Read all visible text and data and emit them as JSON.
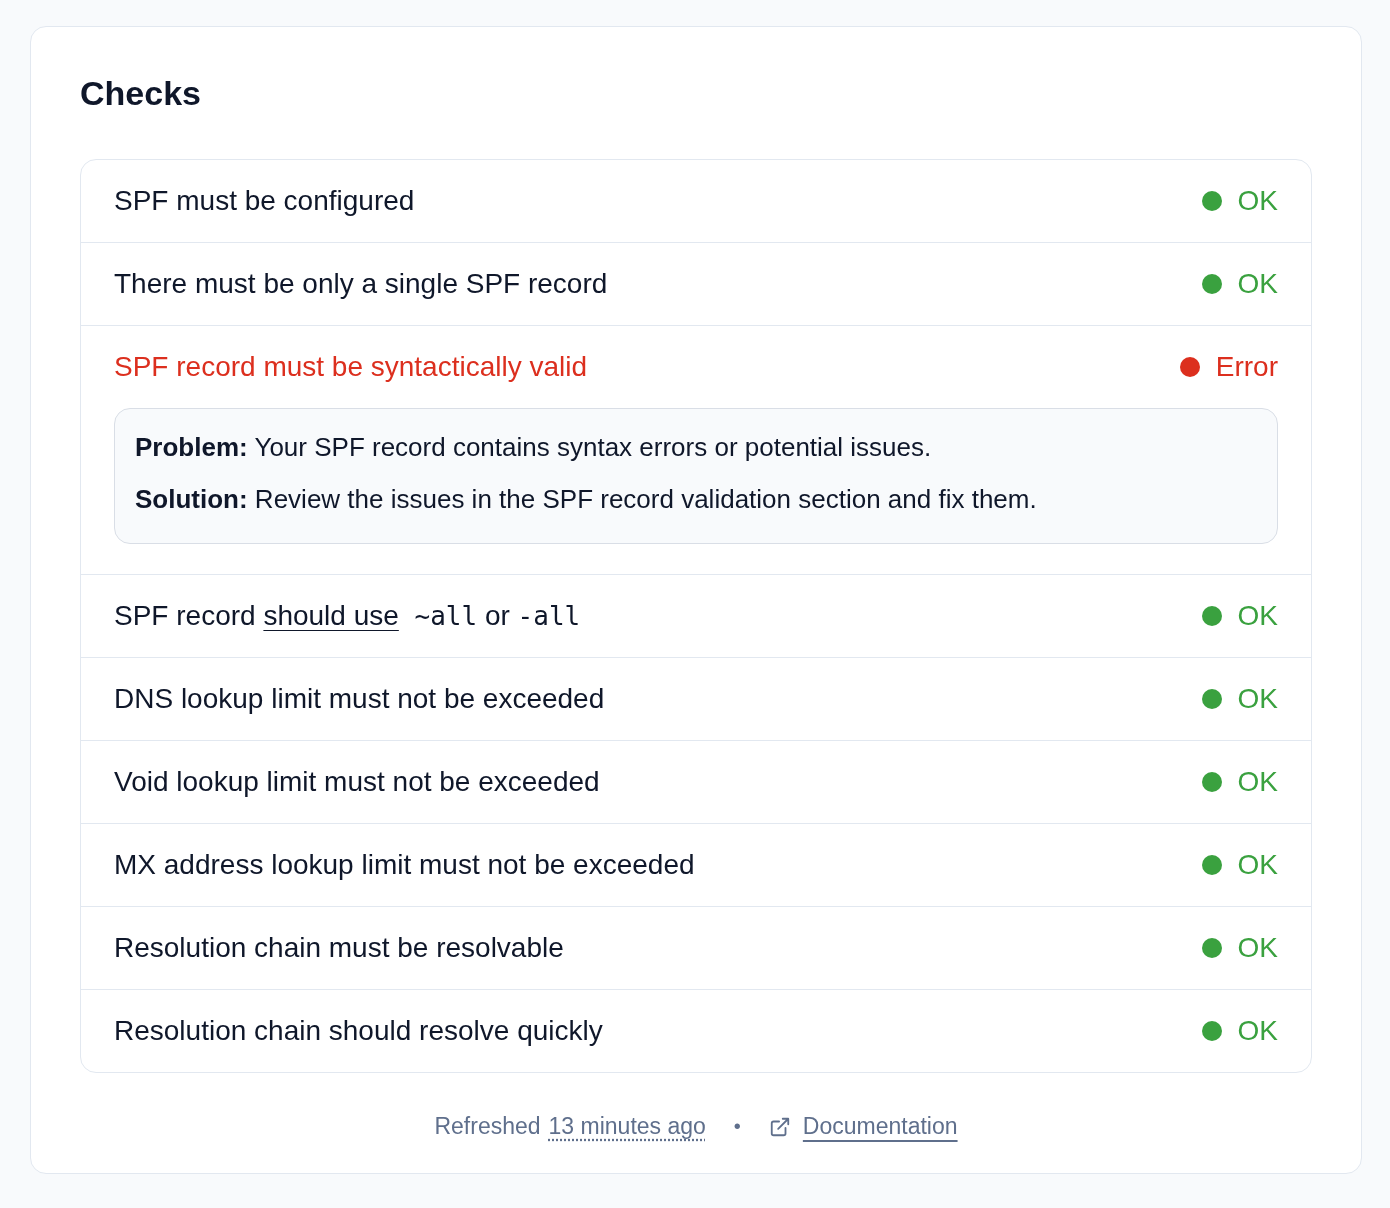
{
  "card": {
    "title": "Checks",
    "checks": [
      {
        "label": [
          {
            "kind": "text",
            "text": "SPF must be configured"
          }
        ],
        "kind": "ok",
        "status_text": "OK"
      },
      {
        "label": [
          {
            "kind": "text",
            "text": "There must be only a single SPF record"
          }
        ],
        "kind": "ok",
        "status_text": "OK"
      },
      {
        "label": [
          {
            "kind": "text",
            "text": "SPF record must be syntactically valid"
          }
        ],
        "kind": "error",
        "status_text": "Error",
        "details": [
          {
            "label": "Problem:",
            "text": "Your SPF record contains syntax errors or potential issues."
          },
          {
            "label": "Solution:",
            "text": "Review the issues in the SPF record validation section and fix them."
          }
        ]
      },
      {
        "label": [
          {
            "kind": "text",
            "text": "SPF record "
          },
          {
            "kind": "link",
            "text": "should use"
          },
          {
            "kind": "code",
            "text": " ~all"
          },
          {
            "kind": "text",
            "text": " or "
          },
          {
            "kind": "code",
            "text": "-all"
          }
        ],
        "kind": "ok",
        "status_text": "OK"
      },
      {
        "label": [
          {
            "kind": "text",
            "text": "DNS lookup limit must not be exceeded"
          }
        ],
        "kind": "ok",
        "status_text": "OK"
      },
      {
        "label": [
          {
            "kind": "text",
            "text": "Void lookup limit must not be exceeded"
          }
        ],
        "kind": "ok",
        "status_text": "OK"
      },
      {
        "label": [
          {
            "kind": "text",
            "text": "MX address lookup limit must not be exceeded"
          }
        ],
        "kind": "ok",
        "status_text": "OK"
      },
      {
        "label": [
          {
            "kind": "text",
            "text": "Resolution chain must be resolvable"
          }
        ],
        "kind": "ok",
        "status_text": "OK"
      },
      {
        "label": [
          {
            "kind": "text",
            "text": "Resolution chain should resolve quickly"
          }
        ],
        "kind": "ok",
        "status_text": "OK"
      }
    ],
    "footer": {
      "refreshed_label": "Refreshed",
      "refreshed_time": "13 minutes ago",
      "separator": "•",
      "link": "Documentation"
    }
  }
}
